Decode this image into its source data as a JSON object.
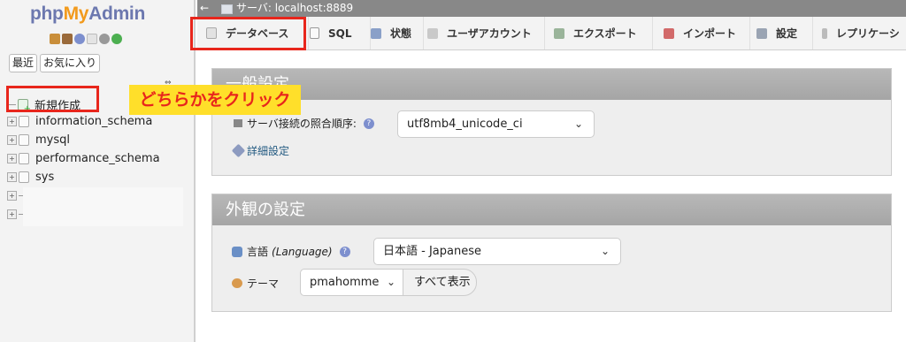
{
  "sidebar": {
    "logo": {
      "part1": "php",
      "part2": "My",
      "part3": "Admin"
    },
    "nav_icons": [
      "home-icon",
      "exit-icon",
      "help-icon",
      "docs-icon",
      "settings-icon",
      "reload-icon"
    ],
    "recent_tab": "最近",
    "favorites_tab": "お気に入り",
    "tree": [
      {
        "label": "新規作成",
        "type": "new"
      },
      {
        "label": "information_schema",
        "type": "db"
      },
      {
        "label": "mysql",
        "type": "db"
      },
      {
        "label": "performance_schema",
        "type": "db"
      },
      {
        "label": "sys",
        "type": "db"
      }
    ]
  },
  "annotation": {
    "callout": "どちらかをクリック",
    "highlight_color": "#e8261c",
    "callout_bg": "#ffdf2a"
  },
  "topbar": {
    "server_label": "サーバ: localhost:8889"
  },
  "tabs": [
    {
      "label": "データベース",
      "icon": "database-icon"
    },
    {
      "label": "SQL",
      "icon": "sql-icon"
    },
    {
      "label": "状態",
      "icon": "status-icon"
    },
    {
      "label": "ユーザアカウント",
      "icon": "users-icon"
    },
    {
      "label": "エクスポート",
      "icon": "export-icon"
    },
    {
      "label": "インポート",
      "icon": "import-icon"
    },
    {
      "label": "設定",
      "icon": "wrench-icon"
    },
    {
      "label": "レプリケーシ",
      "icon": "replication-icon"
    }
  ],
  "general_settings": {
    "title": "一般設定",
    "collation_label": "サーバ接続の照合順序:",
    "collation_value": "utf8mb4_unicode_ci",
    "more_settings": "詳細設定"
  },
  "appearance_settings": {
    "title": "外観の設定",
    "language_label": "言語",
    "language_label_en": "(Language)",
    "language_value": "日本語 - Japanese",
    "theme_label": "テーマ",
    "theme_value": "pmahomme",
    "view_all": "すべて表示"
  }
}
